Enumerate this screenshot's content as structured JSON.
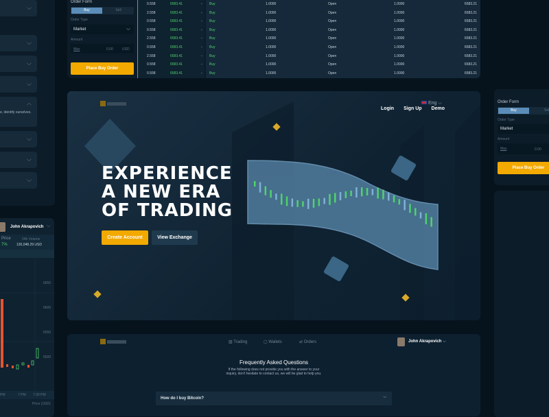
{
  "order_form": {
    "title": "Order Form",
    "buy": "Buy",
    "sell": "Sell",
    "order_type_label": "Order Type",
    "order_type": "Market",
    "amount_label": "Amount",
    "max": "Max",
    "amount": "0.00",
    "currency": "USD",
    "submit": "Place Buy Order"
  },
  "order_book": [
    [
      "0.558",
      "6583.41",
      "-"
    ],
    [
      "2.558",
      "6583.41",
      "-"
    ],
    [
      "0.558",
      "6583.41",
      "-"
    ],
    [
      "0.558",
      "6583.41",
      "-"
    ],
    [
      "2.558",
      "6583.41",
      "-"
    ],
    [
      "0.558",
      "6583.41",
      "-"
    ],
    [
      "2.558",
      "6583.41",
      "-"
    ],
    [
      "0.558",
      "6583.41",
      "-"
    ],
    [
      "0.558",
      "6583.41",
      "-"
    ]
  ],
  "orders": [
    [
      "Buy",
      "1.0000",
      "Open",
      "1.0000",
      "6583.21"
    ],
    [
      "Buy",
      "1.0000",
      "Open",
      "1.0000",
      "6583.21"
    ],
    [
      "Buy",
      "1.0000",
      "Open",
      "1.0000",
      "6583.21"
    ],
    [
      "Buy",
      "1.0000",
      "Open",
      "1.0000",
      "6583.21"
    ],
    [
      "Buy",
      "1.0000",
      "Open",
      "1.0000",
      "6583.21"
    ],
    [
      "Buy",
      "1.0000",
      "Open",
      "1.0000",
      "6583.21"
    ],
    [
      "Buy",
      "1.0000",
      "Open",
      "1.0000",
      "6583.21"
    ],
    [
      "Buy",
      "1.0000",
      "Open",
      "1.0000",
      "6583.21"
    ],
    [
      "Buy",
      "1.0000",
      "Open",
      "1.0000",
      "6583.21"
    ]
  ],
  "left_faq": {
    "open_text": "e, identify ourselves."
  },
  "left_chart": {
    "user": "John Akrapovich",
    "price_label": "Price",
    "price_change": "7%",
    "volume_label": "24h Volume",
    "volume": "130,048.29 USD",
    "y_ticks": [
      "6650",
      "6600",
      "6550",
      "6500"
    ],
    "x_ticks": [
      "PM",
      "7 PM",
      "7:30 PM"
    ],
    "footer": "Price (USD)"
  },
  "hero": {
    "nav": [
      "Login",
      "Sign Up",
      "Demo"
    ],
    "lang": "Eng",
    "title_lines": [
      "EXPERIENCE",
      "A NEW ERA",
      "OF TRADING"
    ],
    "create": "Create Account",
    "view": "View Exchange"
  },
  "bottom": {
    "tabs": [
      "Trading",
      "Wallets",
      "Orders"
    ],
    "user": "John Akrapovich",
    "faq_title": "Frequently Asked Questions",
    "faq_sub1": "If the following does not provide you with the answer to your",
    "faq_sub2": "inquiry, don't hesitate to contact us, we will be glad to help you.",
    "question": "How do I buy Bitcoin?"
  },
  "colors": {
    "accent": "#f2a900",
    "green": "#4fd36b",
    "red": "#e8542f",
    "buy_tab": "#5b8db8"
  }
}
